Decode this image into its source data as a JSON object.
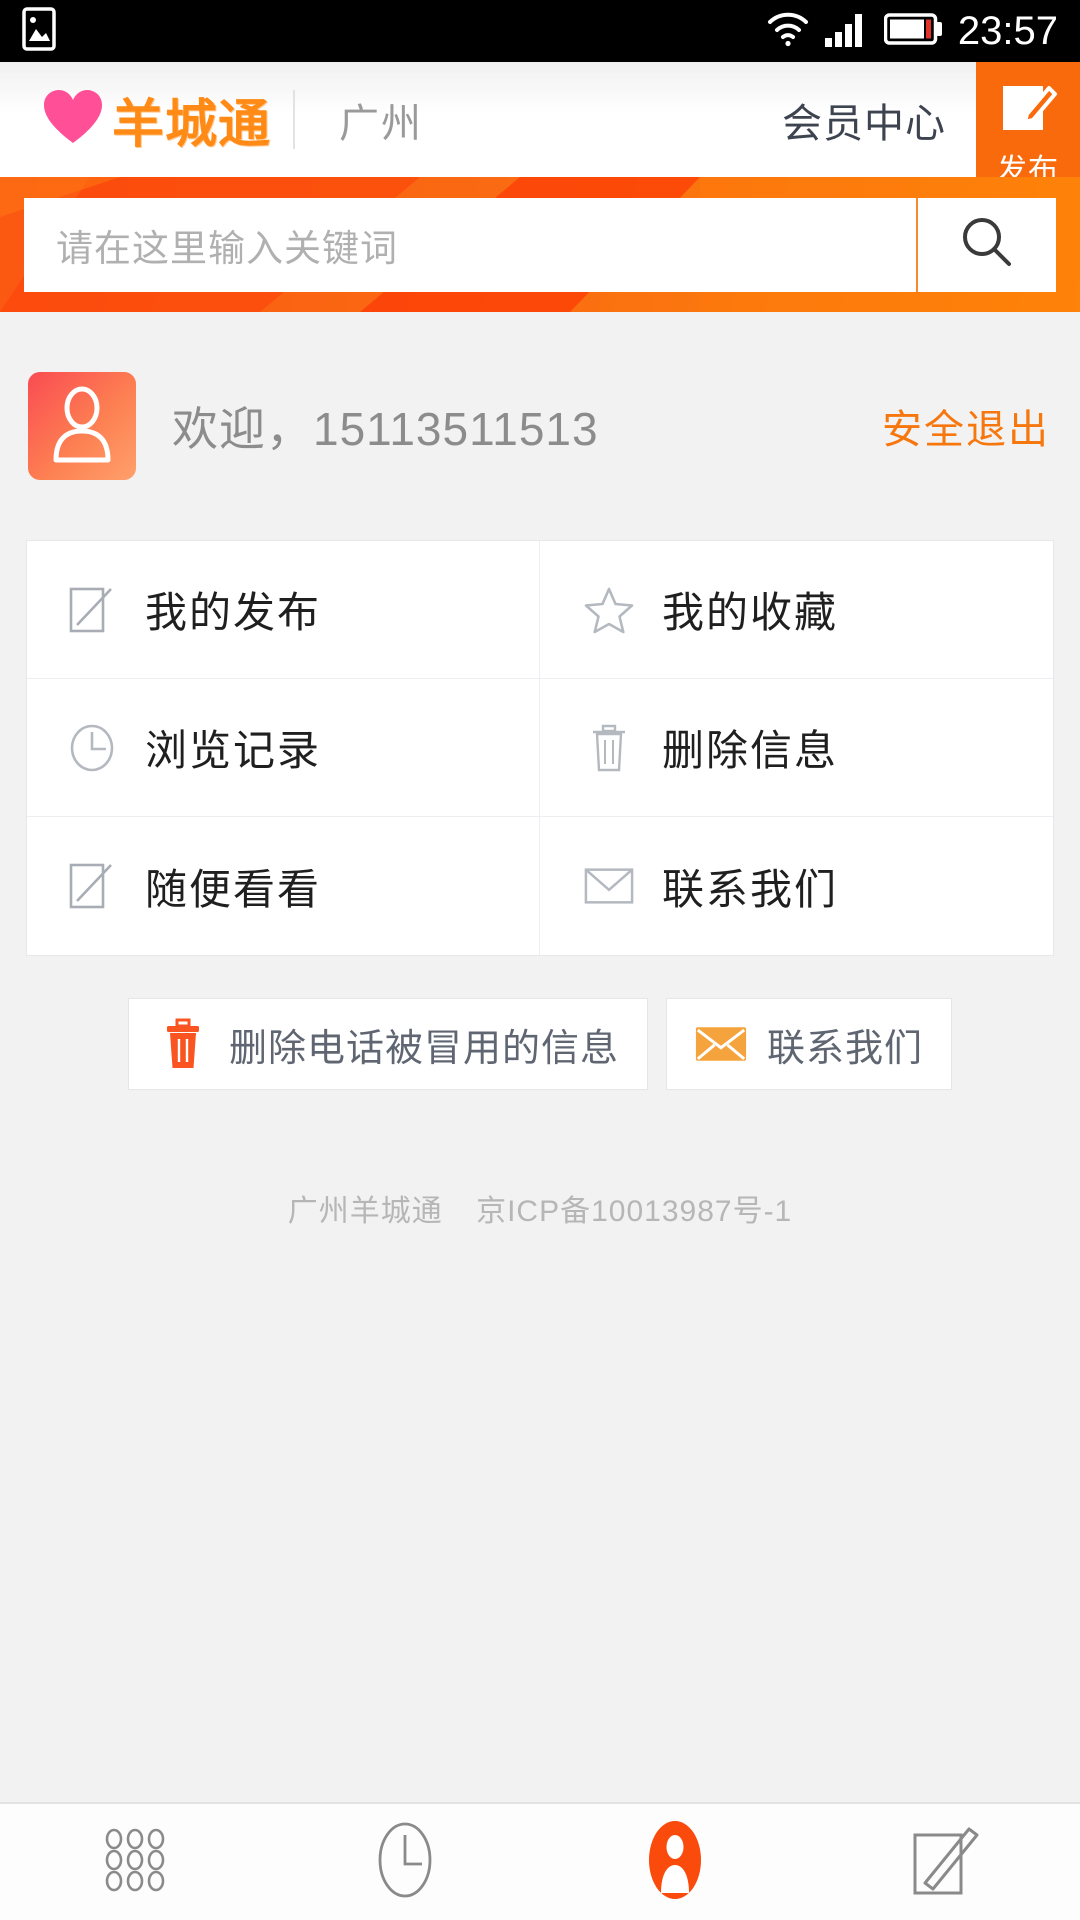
{
  "statusbar": {
    "time": "23:57",
    "icons": [
      "image-icon",
      "wifi-icon",
      "signal-icon",
      "battery-icon"
    ]
  },
  "header": {
    "logo_text": "羊城通",
    "logo_icon": "heart-icon",
    "city": "广州",
    "member_center": "会员中心",
    "publish_label": "发布",
    "publish_icon": "compose-icon",
    "accent_orange": "#f96a0d",
    "logo_pink": "#ff4f97"
  },
  "search": {
    "placeholder": "请在这里输入关键词",
    "value": "",
    "button_icon": "search-icon"
  },
  "user": {
    "avatar_icon": "person-icon",
    "welcome": "欢迎，15113511513",
    "logout_label": "安全退出",
    "logout_color": "#f7770f"
  },
  "menu": {
    "items": [
      {
        "label": "我的发布",
        "icon": "compose-icon"
      },
      {
        "label": "我的收藏",
        "icon": "star-icon"
      },
      {
        "label": "浏览记录",
        "icon": "clock-icon"
      },
      {
        "label": "删除信息",
        "icon": "trash-icon"
      },
      {
        "label": "随便看看",
        "icon": "compose-icon"
      },
      {
        "label": "联系我们",
        "icon": "envelope-icon"
      }
    ]
  },
  "actions": [
    {
      "label": "删除电话被冒用的信息",
      "icon": "trash-icon",
      "icon_color": "#fa5521"
    },
    {
      "label": "联系我们",
      "icon": "envelope-icon",
      "icon_color": "#f5a33c"
    }
  ],
  "footer": {
    "site_name": "广州羊城通",
    "icp": "京ICP备10013987号-1"
  },
  "bottom_nav": {
    "items": [
      {
        "icon": "grid-icon",
        "active": false
      },
      {
        "icon": "clock-icon",
        "active": false
      },
      {
        "icon": "person-icon",
        "active": true
      },
      {
        "icon": "compose-icon",
        "active": false
      }
    ],
    "active_color": "#fa4a0c"
  }
}
